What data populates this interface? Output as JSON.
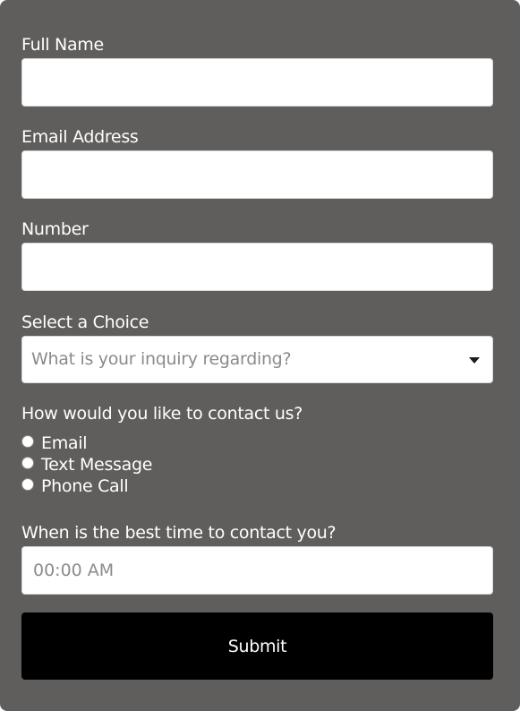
{
  "form": {
    "full_name": {
      "label": "Full Name",
      "value": "",
      "placeholder": ""
    },
    "email": {
      "label": "Email Address",
      "value": "",
      "placeholder": ""
    },
    "number": {
      "label": "Number",
      "value": "",
      "placeholder": ""
    },
    "choice": {
      "label": "Select a Choice",
      "placeholder": "What is your inquiry regarding?"
    },
    "contact_method": {
      "label": "How would you like to contact us?",
      "options": [
        {
          "label": "Email",
          "selected": false
        },
        {
          "label": "Text Message",
          "selected": false
        },
        {
          "label": "Phone Call",
          "selected": false
        }
      ]
    },
    "best_time": {
      "label": "When is the best time to contact you?",
      "value": "",
      "placeholder": "00:00 AM"
    },
    "submit_label": "Submit"
  },
  "colors": {
    "card_background": "#5f5e5c",
    "input_background": "#ffffff",
    "submit_background": "#000000",
    "label_text": "#ffffff",
    "placeholder_text": "#8b8b8b"
  },
  "icons": {
    "select_caret": "caret-down-icon"
  }
}
